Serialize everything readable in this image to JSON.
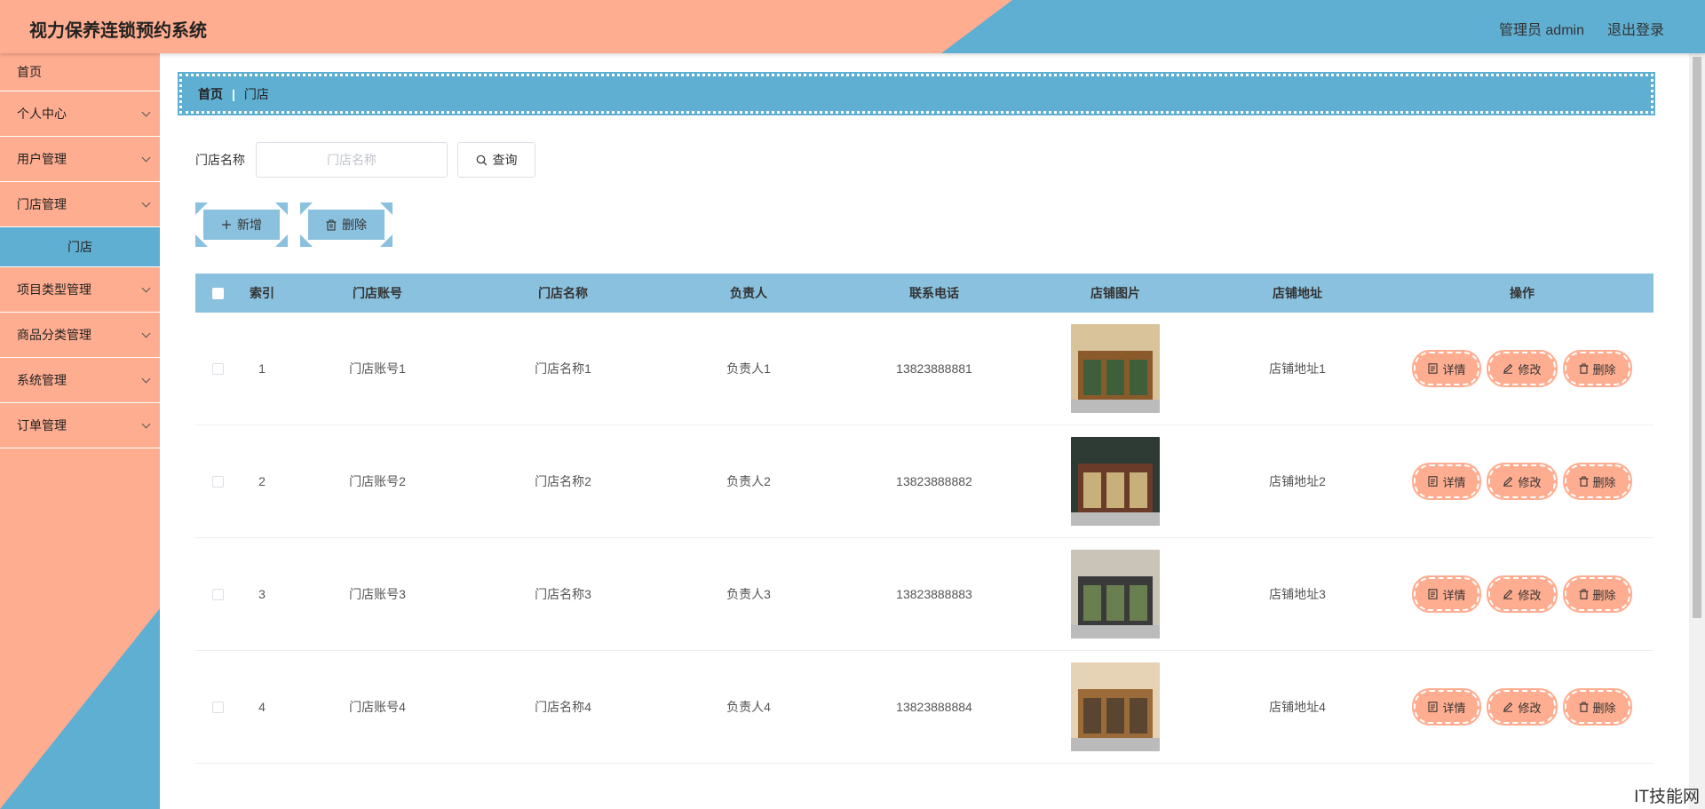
{
  "header": {
    "title": "视力保养连锁预约系统",
    "user_label": "管理员 admin",
    "logout_label": "退出登录"
  },
  "sidebar": {
    "items": [
      {
        "label": "首页",
        "expandable": false
      },
      {
        "label": "个人中心",
        "expandable": true
      },
      {
        "label": "用户管理",
        "expandable": true
      },
      {
        "label": "门店管理",
        "expandable": true
      },
      {
        "label": "门店",
        "expandable": false,
        "active": true
      },
      {
        "label": "项目类型管理",
        "expandable": true
      },
      {
        "label": "商品分类管理",
        "expandable": true
      },
      {
        "label": "系统管理",
        "expandable": true
      },
      {
        "label": "订单管理",
        "expandable": true
      }
    ]
  },
  "breadcrumb": {
    "home": "首页",
    "separator": "|",
    "current": "门店"
  },
  "search": {
    "label": "门店名称",
    "placeholder": "门店名称",
    "value": "",
    "button_label": "查询"
  },
  "actions": {
    "add_label": "新增",
    "delete_label": "删除"
  },
  "table": {
    "columns": [
      "索引",
      "门店账号",
      "门店名称",
      "负责人",
      "联系电话",
      "店铺图片",
      "店铺地址",
      "操作"
    ],
    "rows": [
      {
        "index": "1",
        "account": "门店账号1",
        "name": "门店名称1",
        "owner": "负责人1",
        "phone": "13823888881",
        "address": "店铺地址1"
      },
      {
        "index": "2",
        "account": "门店账号2",
        "name": "门店名称2",
        "owner": "负责人2",
        "phone": "13823888882",
        "address": "店铺地址2"
      },
      {
        "index": "3",
        "account": "门店账号3",
        "name": "门店名称3",
        "owner": "负责人3",
        "phone": "13823888883",
        "address": "店铺地址3"
      },
      {
        "index": "4",
        "account": "门店账号4",
        "name": "门店名称4",
        "owner": "负责人4",
        "phone": "13823888884",
        "address": "店铺地址4"
      }
    ],
    "op_labels": {
      "detail": "详情",
      "edit": "修改",
      "delete": "删除"
    }
  },
  "colors": {
    "salmon": "#ffad90",
    "blue": "#5fafd3",
    "light_blue": "#8ac1de"
  },
  "watermark": "IT技能网"
}
